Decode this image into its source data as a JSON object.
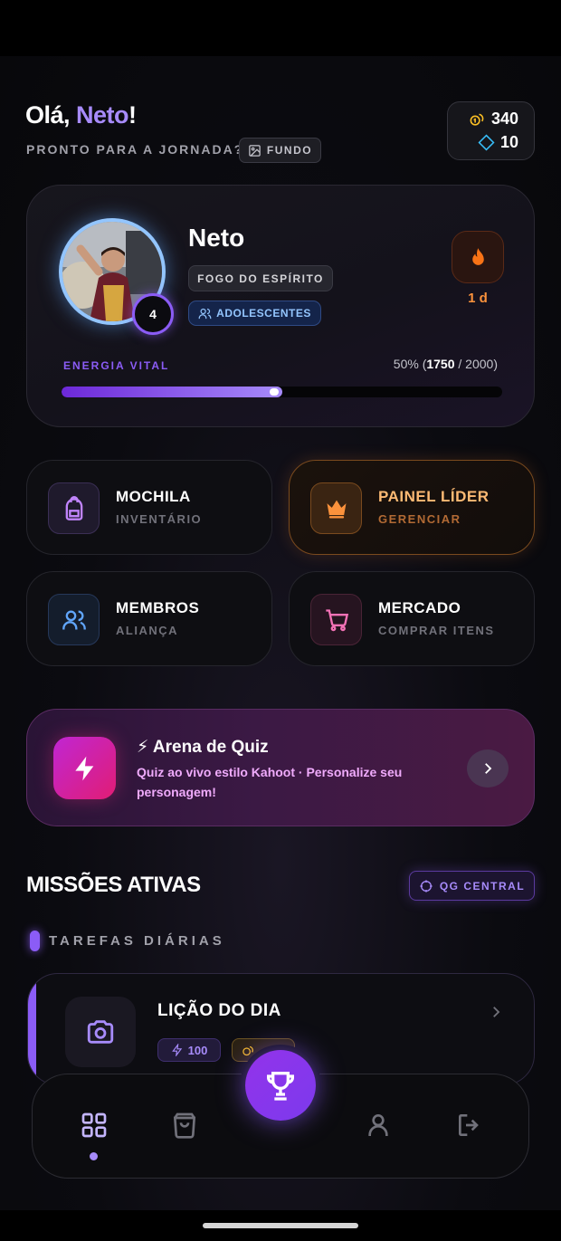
{
  "header": {
    "greeting_prefix": "Olá, ",
    "user_name": "Neto",
    "greeting_suffix": "!",
    "subtitle": "PRONTO PARA A JORNADA?",
    "background_button": "FUNDO"
  },
  "currency": {
    "coins": "340",
    "gems": "10"
  },
  "profile": {
    "name": "Neto",
    "level": "4",
    "title": "FOGO DO ESPÍRITO",
    "group": "ADOLESCENTES",
    "streak": "1 d",
    "energy_label": "ENERGIA VITAL",
    "energy_percent_text": "50% (",
    "energy_current": "1750",
    "energy_max_text": " / 2000)",
    "energy_fraction": 0.5
  },
  "tiles": [
    {
      "title": "MOCHILA",
      "subtitle": "INVENTÁRIO",
      "icon": "backpack-icon"
    },
    {
      "title": "PAINEL LÍDER",
      "subtitle": "GERENCIAR",
      "icon": "crown-icon"
    },
    {
      "title": "MEMBROS",
      "subtitle": "ALIANÇA",
      "icon": "users-icon"
    },
    {
      "title": "MERCADO",
      "subtitle": "COMPRAR ITENS",
      "icon": "cart-icon"
    }
  ],
  "quiz": {
    "title": "⚡ Arena de Quiz",
    "description": "Quiz ao vivo estilo Kahoot · Personalize seu personagem!"
  },
  "missions": {
    "title": "MISSÕES ATIVAS",
    "hq_button": "QG CENTRAL",
    "daily_label": "TAREFAS DIÁRIAS",
    "tasks": [
      {
        "title": "LIÇÃO DO DIA",
        "xp": "100",
        "icon": "camera-icon"
      }
    ]
  },
  "nav": {
    "items": [
      "home-icon",
      "bag-icon",
      "trophy-icon",
      "user-icon",
      "logout-icon"
    ],
    "active": "home"
  },
  "colors": {
    "accent": "#8b5cf6",
    "leader": "#fdba74",
    "group": "#93c5fd",
    "streak": "#fb923c"
  }
}
